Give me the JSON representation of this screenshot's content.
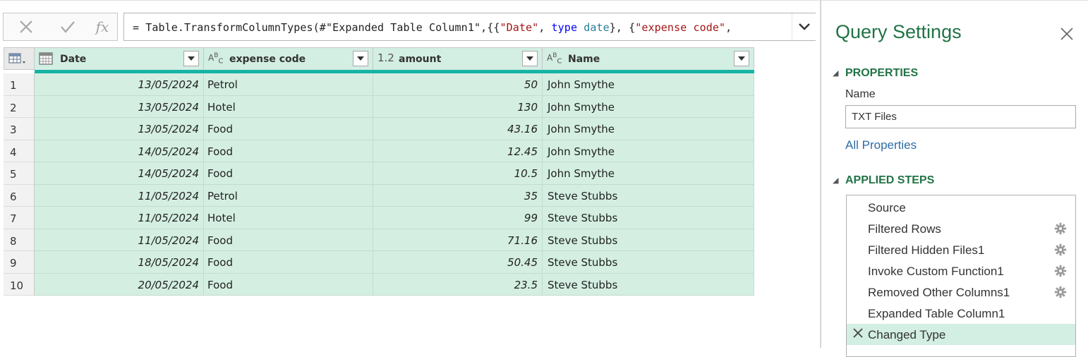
{
  "formula_bar": {
    "fx_label": "fx",
    "formula_parts": [
      {
        "t": "= Table.TransformColumnTypes(#",
        "c": "plain"
      },
      {
        "t": "\"Expanded Table Column1\"",
        "c": "plain"
      },
      {
        "t": ",{{",
        "c": "plain"
      },
      {
        "t": "\"Date\"",
        "c": "str"
      },
      {
        "t": ", ",
        "c": "plain"
      },
      {
        "t": "type",
        "c": "kw"
      },
      {
        "t": " ",
        "c": "plain"
      },
      {
        "t": "date",
        "c": "type"
      },
      {
        "t": "}, {",
        "c": "plain"
      },
      {
        "t": "\"expense code\"",
        "c": "str"
      },
      {
        "t": ",",
        "c": "plain"
      }
    ]
  },
  "table": {
    "columns": [
      {
        "type_label": "calendar",
        "name": "Date"
      },
      {
        "type_label": "ABC",
        "name": "expense code"
      },
      {
        "type_label": "1.2",
        "name": "amount"
      },
      {
        "type_label": "ABC",
        "name": "Name"
      }
    ],
    "rows": [
      {
        "n": "1",
        "date": "13/05/2024",
        "code": "Petrol",
        "amount": "50",
        "name": "John Smythe"
      },
      {
        "n": "2",
        "date": "13/05/2024",
        "code": "Hotel",
        "amount": "130",
        "name": "John Smythe"
      },
      {
        "n": "3",
        "date": "13/05/2024",
        "code": "Food",
        "amount": "43.16",
        "name": "John Smythe"
      },
      {
        "n": "4",
        "date": "14/05/2024",
        "code": "Food",
        "amount": "12.45",
        "name": "John Smythe"
      },
      {
        "n": "5",
        "date": "14/05/2024",
        "code": "Food",
        "amount": "10.5",
        "name": "John Smythe"
      },
      {
        "n": "6",
        "date": "11/05/2024",
        "code": "Petrol",
        "amount": "35",
        "name": "Steve Stubbs"
      },
      {
        "n": "7",
        "date": "11/05/2024",
        "code": "Hotel",
        "amount": "99",
        "name": "Steve Stubbs"
      },
      {
        "n": "8",
        "date": "11/05/2024",
        "code": "Food",
        "amount": "71.16",
        "name": "Steve Stubbs"
      },
      {
        "n": "9",
        "date": "18/05/2024",
        "code": "Food",
        "amount": "50.45",
        "name": "Steve Stubbs"
      },
      {
        "n": "10",
        "date": "20/05/2024",
        "code": "Food",
        "amount": "23.5",
        "name": "Steve Stubbs"
      }
    ]
  },
  "query_settings": {
    "title": "Query Settings",
    "properties_heading": "PROPERTIES",
    "name_label": "Name",
    "name_value": "TXT Files",
    "all_properties_link": "All Properties",
    "applied_steps_heading": "APPLIED STEPS",
    "steps": [
      {
        "label": "Source",
        "gear": false,
        "selected": false
      },
      {
        "label": "Filtered Rows",
        "gear": true,
        "selected": false
      },
      {
        "label": "Filtered Hidden Files1",
        "gear": true,
        "selected": false
      },
      {
        "label": "Invoke Custom Function1",
        "gear": true,
        "selected": false
      },
      {
        "label": "Removed Other Columns1",
        "gear": true,
        "selected": false
      },
      {
        "label": "Expanded Table Column1",
        "gear": false,
        "selected": false
      },
      {
        "label": "Changed Type",
        "gear": false,
        "selected": true
      }
    ]
  },
  "colors": {
    "accent_green": "#217346",
    "header_teal_bar": "#16b4a4",
    "cell_bg": "#d4efe2",
    "link_blue": "#2e6ca6"
  }
}
